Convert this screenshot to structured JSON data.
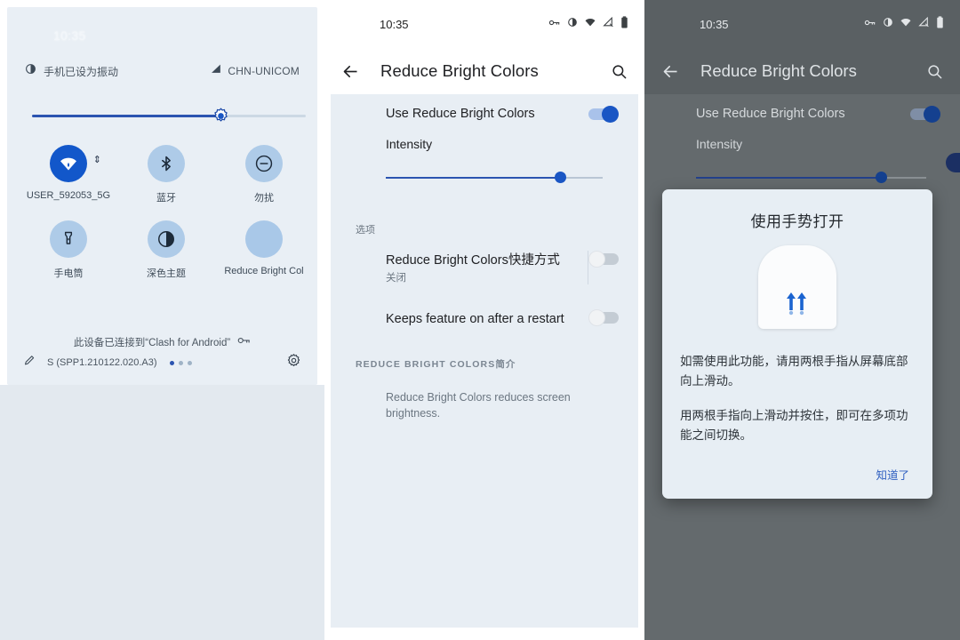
{
  "panel_quick_settings": {
    "status_time": "10:35",
    "ringer_text": "手机已设为振动",
    "carrier": "CHN-UNICOM",
    "brightness_percent": 66,
    "tiles": [
      {
        "label": "USER_592053_5G",
        "icon": "wifi-icon",
        "state": "on"
      },
      {
        "label": "蓝牙",
        "icon": "bluetooth-icon",
        "state": "off"
      },
      {
        "label": "勿扰",
        "icon": "do-not-disturb-icon",
        "state": "off"
      },
      {
        "label": "手电筒",
        "icon": "flashlight-icon",
        "state": "off"
      },
      {
        "label": "深色主题",
        "icon": "dark-theme-icon",
        "state": "off"
      },
      {
        "label": "Reduce Bright Col",
        "icon": "reduce-bright-colors-icon",
        "state": "off"
      }
    ],
    "vpn_text": "此设备已连接到“Clash for Android”",
    "build_text": "S (SPP1.210122.020.A3)",
    "page_dots": 3,
    "page_dot_active": 1
  },
  "panel_settings": {
    "status_time": "10:35",
    "status_icons": [
      "vpn-key-icon",
      "vibrate-icon",
      "wifi-icon",
      "signal-icon",
      "battery-icon"
    ],
    "app_bar": {
      "back_label": "back-arrow",
      "title": "Reduce Bright Colors",
      "search_label": "search"
    },
    "main_toggle": {
      "label": "Use Reduce Bright Colors",
      "state": "on"
    },
    "intensity": {
      "label": "Intensity",
      "value_percent": 80
    },
    "options_header": "选项",
    "options": [
      {
        "title": "Reduce Bright Colors快捷方式",
        "subtitle": "关闭",
        "state": "off",
        "has_divider": true
      },
      {
        "title": "Keeps feature on after a restart",
        "subtitle": "",
        "state": "off",
        "has_divider": false
      }
    ],
    "about_header": "REDUCE BRIGHT COLORS简介",
    "about_text": "Reduce Bright Colors reduces screen brightness."
  },
  "panel_dialog": {
    "status_time": "10:35",
    "app_bar": {
      "title": "Reduce Bright Colors"
    },
    "main_toggle": {
      "label": "Use Reduce Bright Colors",
      "state": "on"
    },
    "intensity": {
      "label": "Intensity",
      "value_percent": 80
    },
    "dialog": {
      "title": "使用手势打开",
      "illustration": "two-finger-swipe-up-icon",
      "paragraphs": [
        "如需使用此功能，请用两根手指从屏幕底部向上滑动。",
        "用两根手指向上滑动并按住，即可在多项功能之间切换。"
      ],
      "confirm_label": "知道了"
    }
  },
  "colors": {
    "accent_blue": "#1a56c4",
    "shade_bg": "#e9eff5",
    "settings_bg": "#e8eef4",
    "scrim": "#5a6063",
    "link_blue": "#2f5fc0"
  }
}
